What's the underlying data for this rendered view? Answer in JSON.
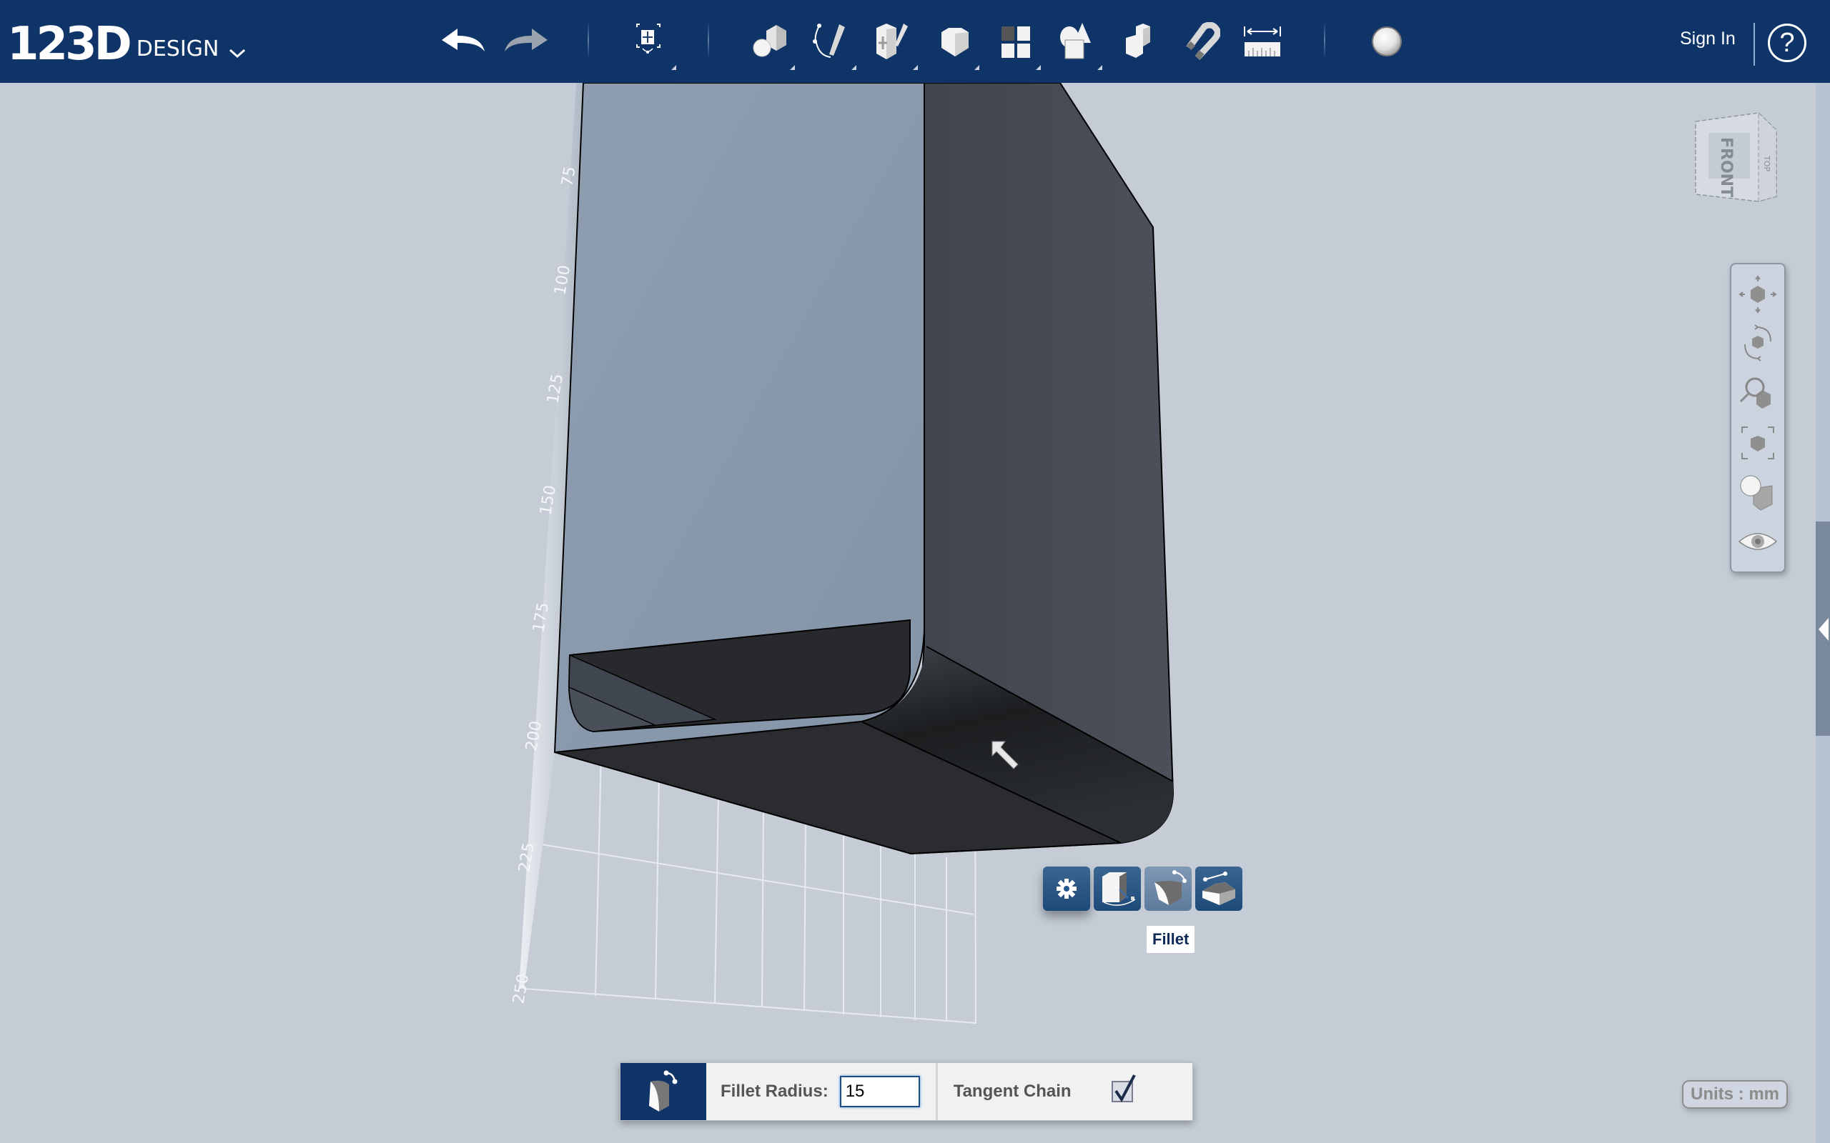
{
  "app": {
    "logo_number": "123D",
    "logo_word": "DESIGN",
    "menu_icon": "chevron-down-icon"
  },
  "toolbar": {
    "undo_icon": "undo-arrow-icon",
    "redo_icon": "redo-arrow-icon",
    "tools": [
      {
        "name": "transform",
        "icon": "transform-icon"
      },
      {
        "name": "primitives",
        "icon": "primitives-icon"
      },
      {
        "name": "sketch",
        "icon": "sketch-icon"
      },
      {
        "name": "construct",
        "icon": "construct-icon"
      },
      {
        "name": "modify",
        "icon": "modify-icon"
      },
      {
        "name": "pattern",
        "icon": "pattern-icon"
      },
      {
        "name": "grouping",
        "icon": "grouping-icon"
      },
      {
        "name": "combine",
        "icon": "combine-icon"
      },
      {
        "name": "snap",
        "icon": "snap-magnet-icon"
      },
      {
        "name": "measure",
        "icon": "measure-ruler-icon"
      },
      {
        "name": "material",
        "icon": "material-sphere-icon"
      }
    ],
    "sign_in": "Sign In",
    "help": "?"
  },
  "viewcube": {
    "front_label": "FRONT",
    "side_label": "TOP"
  },
  "navbar": {
    "items": [
      "pan",
      "orbit",
      "zoom",
      "fit",
      "visual-style",
      "visibility"
    ]
  },
  "ruler": {
    "labels": [
      "75",
      "100",
      "125",
      "150",
      "175",
      "200",
      "225",
      "250"
    ]
  },
  "context_toolbar": {
    "items": [
      {
        "name": "settings",
        "icon": "gear-icon"
      },
      {
        "name": "press-pull",
        "icon": "press-pull-icon"
      },
      {
        "name": "fillet",
        "icon": "fillet-icon",
        "active": true
      },
      {
        "name": "chamfer",
        "icon": "chamfer-icon"
      }
    ],
    "tooltip": "Fillet"
  },
  "fillet_panel": {
    "radius_label": "Fillet Radius:",
    "radius_value": "15",
    "tangent_label": "Tangent Chain",
    "tangent_checked": true
  },
  "units": "Units : mm",
  "colors": {
    "header": "#0f3468",
    "viewport": "#c5ccd6",
    "model_front": "#8a9aac",
    "model_dark": "#2a2c30"
  }
}
